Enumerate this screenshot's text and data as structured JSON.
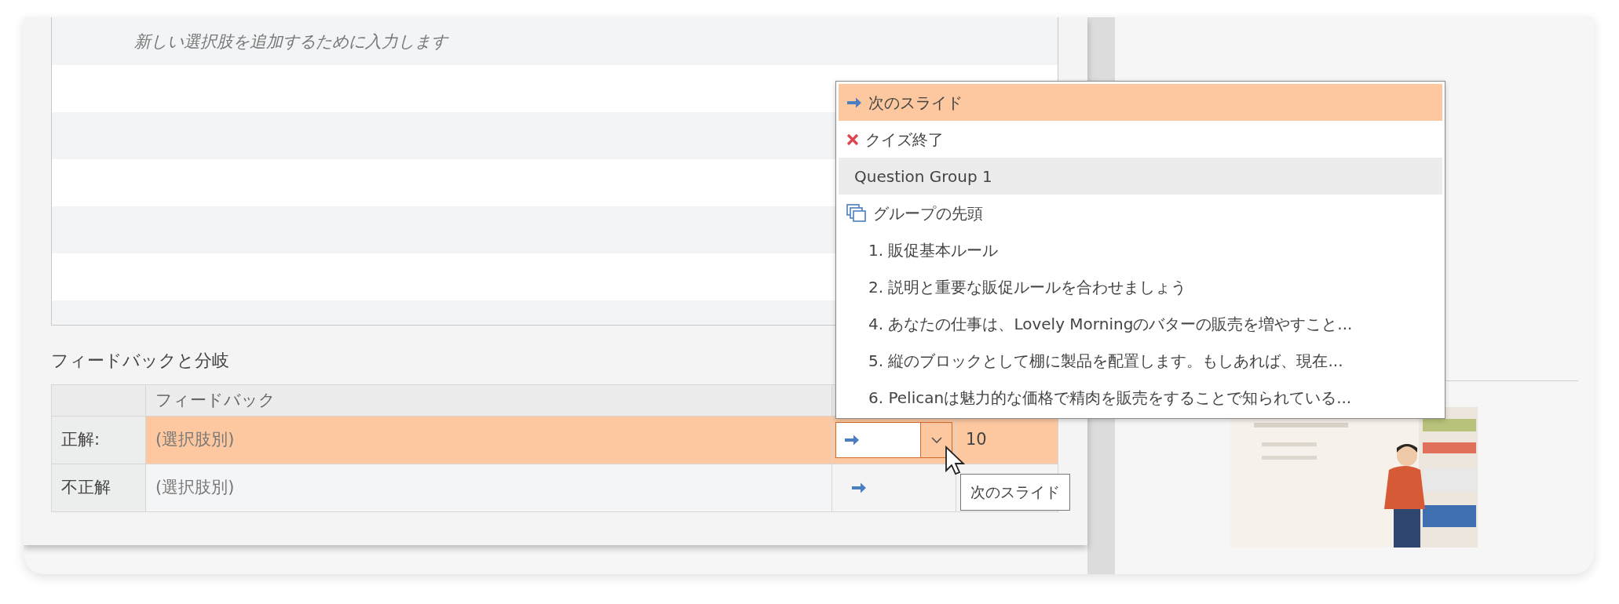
{
  "choices_list": {
    "placeholder": "新しい選択肢を追加するために入力します"
  },
  "feedback_section": {
    "title": "フィードバックと分岐",
    "column_2": "フィードバック",
    "rows": [
      {
        "label": "正解:",
        "feedback": "(選択肢別)",
        "branch": {
          "kind": "next"
        },
        "score": "10",
        "selected": true
      },
      {
        "label": "不正解",
        "feedback": "(選択肢別)",
        "branch": {
          "kind": "next"
        },
        "selected": false
      }
    ]
  },
  "branch_dropdown": {
    "items": [
      {
        "kind": "next",
        "label": "次のスライド",
        "selected": true
      },
      {
        "kind": "end",
        "label": "クイズ終了",
        "selected": false
      },
      {
        "kind": "group",
        "label": "Question Group 1",
        "selected": false
      },
      {
        "kind": "group_start",
        "label": "グループの先頭",
        "selected": false
      },
      {
        "kind": "slide",
        "label": "1. 販促基本ルール",
        "selected": false
      },
      {
        "kind": "slide",
        "label": "2. 説明と重要な販促ルールを合わせましょう",
        "selected": false
      },
      {
        "kind": "slide",
        "label": "4. あなたの仕事は、Lovely Morningのバターの販売を増やすこと...",
        "selected": false
      },
      {
        "kind": "slide",
        "label": "5. 縦のブロックとして棚に製品を配置します。もしあれば、現在...",
        "selected": false
      },
      {
        "kind": "slide",
        "label": "6. Pelicanは魅力的な価格で精肉を販売をすることで知られている...",
        "selected": false
      }
    ]
  },
  "tooltip": "次のスライド"
}
